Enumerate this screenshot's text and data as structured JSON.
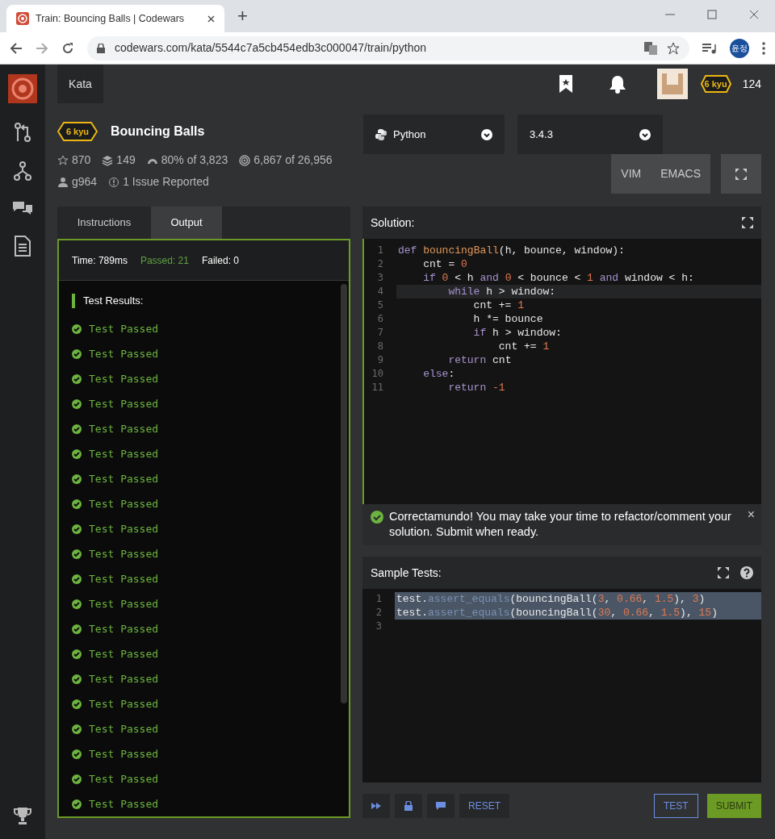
{
  "browser": {
    "tab_title": "Train: Bouncing Balls | Codewars",
    "new_tab": "+",
    "url": "codewars.com/kata/5544c7a5cb454edb3c000047/train/python",
    "profile": "윤정"
  },
  "header": {
    "nav_tab": "Kata",
    "rank": "6 kyu",
    "honor": "124"
  },
  "kata": {
    "rank": "6 kyu",
    "title": "Bouncing Balls",
    "stats": [
      {
        "kind": "star",
        "text": "870"
      },
      {
        "kind": "layers",
        "text": "149"
      },
      {
        "kind": "gauge",
        "text": "80% of 3,823"
      },
      {
        "kind": "target",
        "text": "6,867 of 26,956"
      },
      {
        "kind": "user",
        "text": "g964"
      },
      {
        "kind": "issue",
        "text": "1 Issue Reported"
      }
    ]
  },
  "language": "Python",
  "version": "3.4.3",
  "modes": [
    "VIM",
    "EMACS"
  ],
  "tabs": [
    {
      "label": "Instructions",
      "selected": false
    },
    {
      "label": "Output",
      "selected": true
    }
  ],
  "output": {
    "time": "Time: 789ms",
    "passed": "Passed: 21",
    "failed": "Failed: 0",
    "heading": "Test Results:",
    "results": [
      "Test Passed",
      "Test Passed",
      "Test Passed",
      "Test Passed",
      "Test Passed",
      "Test Passed",
      "Test Passed",
      "Test Passed",
      "Test Passed",
      "Test Passed",
      "Test Passed",
      "Test Passed",
      "Test Passed",
      "Test Passed",
      "Test Passed",
      "Test Passed",
      "Test Passed",
      "Test Passed",
      "Test Passed",
      "Test Passed"
    ]
  },
  "solution": {
    "title": "Solution:",
    "lines": [
      {
        "num": "1",
        "highlighted": false,
        "tokens": [
          {
            "kind": "kw",
            "text": "def "
          },
          {
            "kind": "fn",
            "text": "bouncingBall"
          },
          {
            "kind": "op",
            "text": "(h, bounce, window):"
          }
        ]
      },
      {
        "num": "2",
        "highlighted": false,
        "tokens": [
          {
            "kind": "op",
            "text": "    cnt = "
          },
          {
            "kind": "num",
            "text": "0"
          }
        ]
      },
      {
        "num": "3",
        "highlighted": false,
        "tokens": [
          {
            "kind": "kw",
            "text": "    if "
          },
          {
            "kind": "num",
            "text": "0"
          },
          {
            "kind": "op",
            "text": " < h "
          },
          {
            "kind": "kw",
            "text": "and "
          },
          {
            "kind": "num",
            "text": "0"
          },
          {
            "kind": "op",
            "text": " < bounce < "
          },
          {
            "kind": "num",
            "text": "1"
          },
          {
            "kind": "kw",
            "text": " and "
          },
          {
            "kind": "op",
            "text": "window < h:"
          }
        ]
      },
      {
        "num": "4",
        "highlighted": true,
        "tokens": [
          {
            "kind": "kw",
            "text": "        while "
          },
          {
            "kind": "op",
            "text": "h > window:"
          }
        ]
      },
      {
        "num": "5",
        "highlighted": false,
        "tokens": [
          {
            "kind": "op",
            "text": "            cnt += "
          },
          {
            "kind": "num",
            "text": "1"
          }
        ]
      },
      {
        "num": "6",
        "highlighted": false,
        "tokens": [
          {
            "kind": "op",
            "text": "            h *= bounce"
          }
        ]
      },
      {
        "num": "7",
        "highlighted": false,
        "tokens": [
          {
            "kind": "kw",
            "text": "            if "
          },
          {
            "kind": "op",
            "text": "h > window:"
          }
        ]
      },
      {
        "num": "8",
        "highlighted": false,
        "tokens": [
          {
            "kind": "op",
            "text": "                cnt += "
          },
          {
            "kind": "num",
            "text": "1"
          }
        ]
      },
      {
        "num": "9",
        "highlighted": false,
        "tokens": [
          {
            "kind": "kw",
            "text": "        return "
          },
          {
            "kind": "op",
            "text": "cnt"
          }
        ]
      },
      {
        "num": "10",
        "highlighted": false,
        "tokens": [
          {
            "kind": "kw",
            "text": "    else"
          },
          {
            "kind": "op",
            "text": ":"
          }
        ]
      },
      {
        "num": "11",
        "highlighted": false,
        "tokens": [
          {
            "kind": "kw",
            "text": "        return "
          },
          {
            "kind": "num",
            "text": "-1"
          }
        ]
      }
    ]
  },
  "notice": {
    "text": "Correctamundo! You may take your time to refactor/comment your solution. Submit when ready.",
    "close": "×"
  },
  "sample_tests": {
    "title": "Sample Tests:",
    "lines": [
      {
        "num": "1",
        "highlighted": true,
        "tokens": [
          {
            "kind": "op",
            "text": "test."
          },
          {
            "kind": "method",
            "text": "assert_equals"
          },
          {
            "kind": "op",
            "text": "(bouncingBall("
          },
          {
            "kind": "num",
            "text": "3"
          },
          {
            "kind": "op",
            "text": ", "
          },
          {
            "kind": "num",
            "text": "0.66"
          },
          {
            "kind": "op",
            "text": ", "
          },
          {
            "kind": "num",
            "text": "1.5"
          },
          {
            "kind": "op",
            "text": "), "
          },
          {
            "kind": "num",
            "text": "3"
          },
          {
            "kind": "op",
            "text": ")"
          }
        ]
      },
      {
        "num": "2",
        "highlighted": true,
        "tokens": [
          {
            "kind": "op",
            "text": "test."
          },
          {
            "kind": "method",
            "text": "assert_equals"
          },
          {
            "kind": "op",
            "text": "(bouncingBall("
          },
          {
            "kind": "num",
            "text": "30"
          },
          {
            "kind": "op",
            "text": ", "
          },
          {
            "kind": "num",
            "text": "0.66"
          },
          {
            "kind": "op",
            "text": ", "
          },
          {
            "kind": "num",
            "text": "1.5"
          },
          {
            "kind": "op",
            "text": "), "
          },
          {
            "kind": "num",
            "text": "15"
          },
          {
            "kind": "op",
            "text": ")"
          }
        ]
      },
      {
        "num": "3",
        "highlighted": false
      }
    ]
  },
  "actions": {
    "reset": "RESET",
    "test": "TEST",
    "submit": "SUBMIT"
  }
}
